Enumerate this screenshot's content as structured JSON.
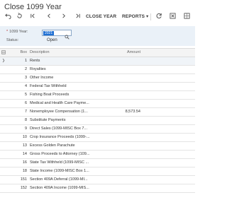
{
  "window": {
    "title": "Close 1099 Year"
  },
  "toolbar": {
    "close_year_label": "CLOSE YEAR",
    "reports_label": "REPORTS ▾"
  },
  "form": {
    "year_label": "1099 Year:",
    "year_value": "2021",
    "status_label": "Status:",
    "status_value": "Open"
  },
  "grid": {
    "headers": {
      "box": "Box",
      "description": "Description",
      "amount": "Amount"
    },
    "rows": [
      {
        "box": "1",
        "description": "Rents",
        "amount": ""
      },
      {
        "box": "2",
        "description": "Royalties",
        "amount": ""
      },
      {
        "box": "3",
        "description": "Other Income",
        "amount": ""
      },
      {
        "box": "4",
        "description": "Federal Tax Withheld",
        "amount": ""
      },
      {
        "box": "5",
        "description": "Fishing Boat Proceeds",
        "amount": ""
      },
      {
        "box": "6",
        "description": "Medical and Health Care Payme...",
        "amount": ""
      },
      {
        "box": "7",
        "description": "Nonemployee Compensation (1...",
        "amount": "8,573.54"
      },
      {
        "box": "8",
        "description": "Substitute Payments",
        "amount": ""
      },
      {
        "box": "9",
        "description": "Direct Sales (1099-MISC Box 7...",
        "amount": ""
      },
      {
        "box": "10",
        "description": "Crop Insurance Proceeds (1099-...",
        "amount": ""
      },
      {
        "box": "13",
        "description": "Excess Golden Parachute",
        "amount": ""
      },
      {
        "box": "14",
        "description": "Gross Proceeds to Attorney (109...",
        "amount": ""
      },
      {
        "box": "16",
        "description": "State Tax Withheld (1099-MISC ...",
        "amount": ""
      },
      {
        "box": "18",
        "description": "State Income (1099-MISC Box 1...",
        "amount": ""
      },
      {
        "box": "151",
        "description": "Section 409A Deferral (1099-MI...",
        "amount": ""
      },
      {
        "box": "152",
        "description": "Section 409A Income (1099-MIS...",
        "amount": ""
      }
    ]
  }
}
